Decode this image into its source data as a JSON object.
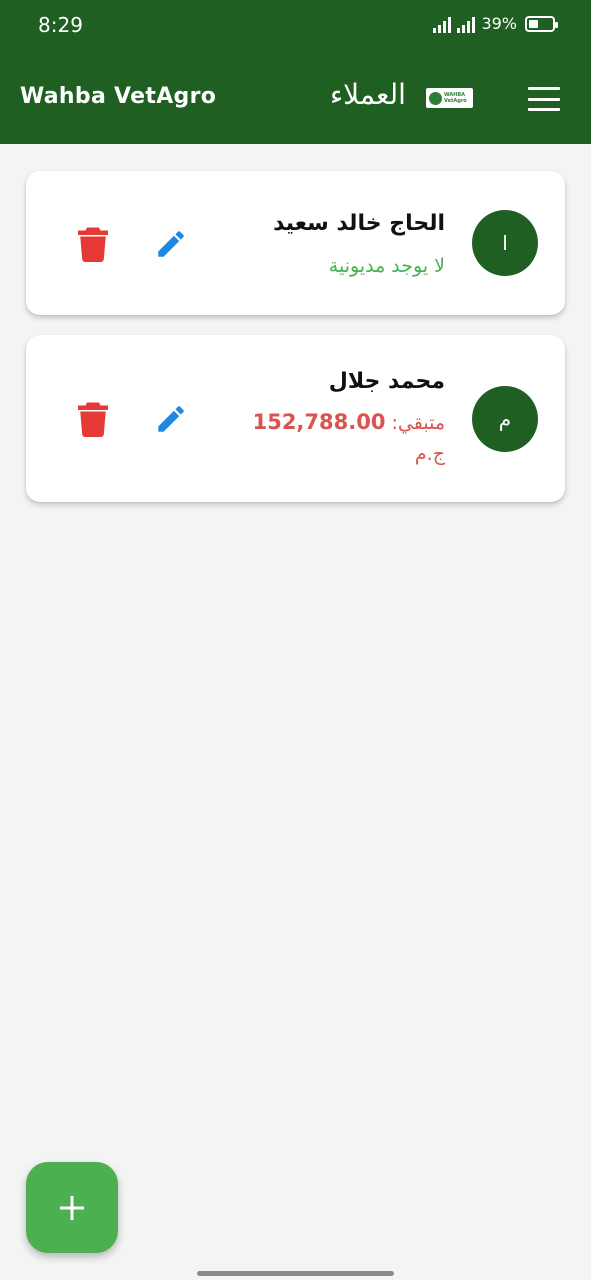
{
  "status_bar": {
    "time": "8:29",
    "battery": "39%"
  },
  "header": {
    "brand": "Wahba VetAgro",
    "title": "العملاء",
    "logo_text_line1": "WAHBA",
    "logo_text_line2": "VetAgro",
    "menu_icon": "hamburger-menu-icon"
  },
  "customers": [
    {
      "initial": "ا",
      "name": "الحاج خالد سعيد",
      "status": "لا يوجد مديونية",
      "status_color": "#4caf50"
    },
    {
      "initial": "م",
      "name": "محمد جلال",
      "remaining_label": "متبقي:",
      "remaining_amount": "152,788.00",
      "currency": "ج.م",
      "status_color": "#d9534f"
    }
  ],
  "actions": {
    "edit_icon": "pencil-icon",
    "delete_icon": "trash-icon"
  },
  "fab": {
    "icon": "plus-icon"
  },
  "colors": {
    "primary": "#1f5f22",
    "fab": "#4caf50",
    "danger": "#e53935",
    "edit": "#1e88e5",
    "ok": "#4caf50"
  }
}
